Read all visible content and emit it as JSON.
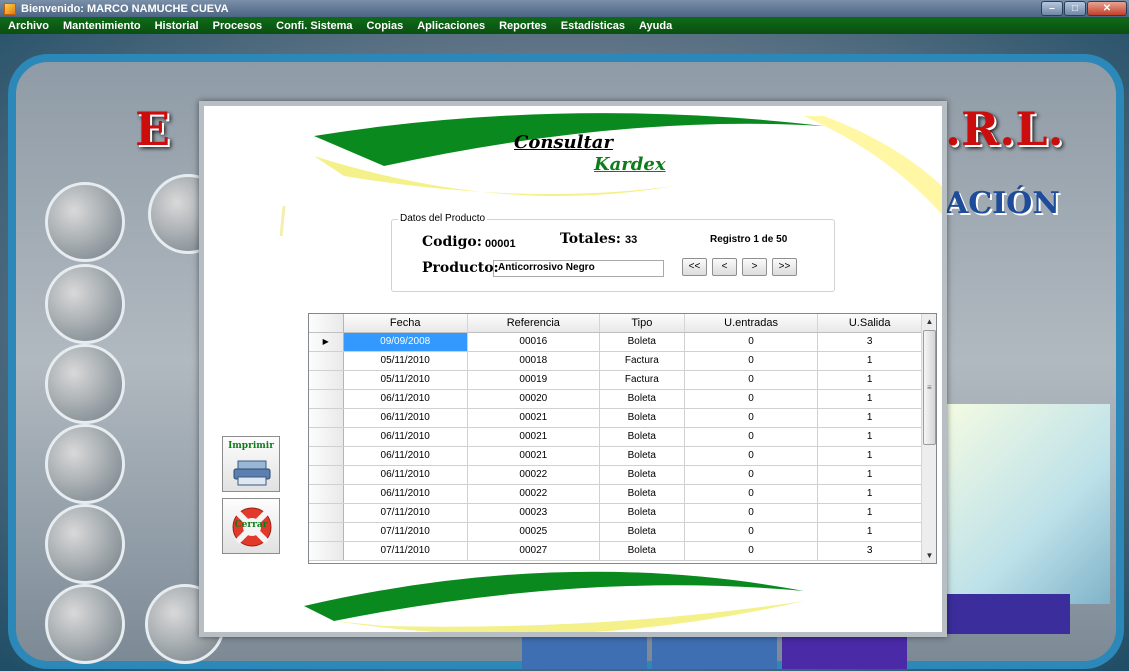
{
  "window": {
    "title": "Bienvenido: MARCO NAMUCHE CUEVA"
  },
  "menu": [
    "Archivo",
    "Mantenimiento",
    "Historial",
    "Procesos",
    "Confi. Sistema",
    "Copias",
    "Aplicaciones",
    "Reportes",
    "Estadísticas",
    "Ayuda"
  ],
  "background": {
    "banner_left": "E",
    "banner_right": ".R.L.",
    "banner_sub": "ACIÓN"
  },
  "dialog": {
    "title_line1": "Consultar",
    "title_line2": "Kardex",
    "group_label": "Datos del Producto",
    "codigo_label": "Codigo:",
    "codigo_value": "00001",
    "totales_label": "Totales:",
    "totales_value": "33",
    "registro": "Registro 1 de 50",
    "producto_label": "Producto:",
    "producto_value": "Anticorrosivo Negro",
    "nav": {
      "first": "<<",
      "prev": "<",
      "next": ">",
      "last": ">>"
    },
    "imprimir_label": "Imprimir",
    "cerrar_label": "Cerrar"
  },
  "grid": {
    "columns": [
      "Fecha",
      "Referencia",
      "Tipo",
      "U.entradas",
      "U.Salida"
    ],
    "rows": [
      [
        "09/09/2008",
        "00016",
        "Boleta",
        "0",
        "3"
      ],
      [
        "05/11/2010",
        "00018",
        "Factura",
        "0",
        "1"
      ],
      [
        "05/11/2010",
        "00019",
        "Factura",
        "0",
        "1"
      ],
      [
        "06/11/2010",
        "00020",
        "Boleta",
        "0",
        "1"
      ],
      [
        "06/11/2010",
        "00021",
        "Boleta",
        "0",
        "1"
      ],
      [
        "06/11/2010",
        "00021",
        "Boleta",
        "0",
        "1"
      ],
      [
        "06/11/2010",
        "00021",
        "Boleta",
        "0",
        "1"
      ],
      [
        "06/11/2010",
        "00022",
        "Boleta",
        "0",
        "1"
      ],
      [
        "06/11/2010",
        "00022",
        "Boleta",
        "0",
        "1"
      ],
      [
        "07/11/2010",
        "00023",
        "Boleta",
        "0",
        "1"
      ],
      [
        "07/11/2010",
        "00025",
        "Boleta",
        "0",
        "1"
      ],
      [
        "07/11/2010",
        "00027",
        "Boleta",
        "0",
        "3"
      ]
    ],
    "selected_row": 0
  },
  "colors": {
    "menu_green": "#0f6b18",
    "title_green": "#0e7c1a",
    "selection": "#3399ff"
  }
}
